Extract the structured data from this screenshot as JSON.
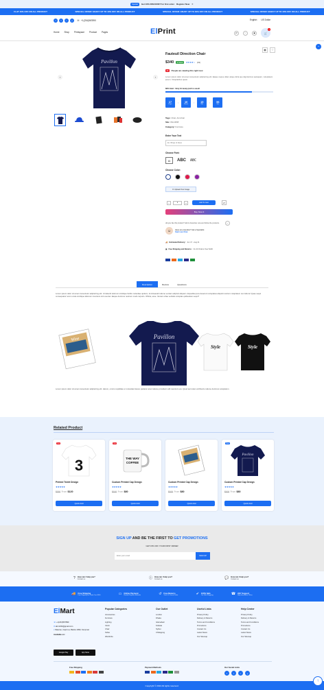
{
  "promo_bar": {
    "badge": "Special",
    "text": "Get 10% DISCOUNT for first order",
    "cta": "Register Now"
  },
  "ticker": [
    "FLAT 40% OFF ON ALL PRODUCT",
    "SPECIAL OFFER: ENJOY UP TO 40% OFF ON ALL PRODUCT",
    "SPECIAL OFFER: ENJOY UP TO 40% OFF ON ALL PRODUCT",
    "SPECIAL OFFER: ENJOY UP TO 40% OFF ON ALL PRODUCT"
  ],
  "header": {
    "phone": "+1(234)567890",
    "language": "English",
    "currency": "US Dollar",
    "logo_a": "El",
    "logo_b": "Print",
    "cart_count": "0"
  },
  "nav": [
    "Home",
    "Shop",
    "Printspace",
    "Product",
    "Pages"
  ],
  "product": {
    "title": "Fauteuil Direction Chair",
    "price": "$340",
    "stock": "In Stock",
    "reviews": "(19)",
    "viewers_badge": "29",
    "viewers": "People are viewing this right now",
    "desc": "Lorem ipsum dolor sit amet consectetur adipisicing elit. Eaque neque ullam atque dicta quo dignissimos quisquam, voluptatem ipsum. Voluptatibus quasi.",
    "sold": "80% Sold : Only 10 item(s) left in stock!",
    "sold_pct": 0.8,
    "countdown": [
      {
        "n": "17",
        "l": "Days"
      },
      {
        "n": "10",
        "l": "Hours"
      },
      {
        "n": "15",
        "l": "Min"
      },
      {
        "n": "56",
        "l": "Sec"
      }
    ],
    "tags_label": "Tags:",
    "tags": "Chair, Armchair",
    "sku_label": "Sku:",
    "sku": "WH-0068",
    "cat_label": "Category:",
    "cat": "Furniture",
    "enter_text": "Enter Your Text",
    "text_placeholder": "Ex: Wings of Ideas",
    "font_label": "Choose Font:",
    "fonts": [
      "ABC",
      "ABC"
    ],
    "color_label": "Choose Color:",
    "colors": [
      "#ffffff",
      "#111111",
      "#e0184a",
      "#8a1fa3"
    ],
    "upload": "Upload Your Image",
    "qty": "1",
    "add_to_cart": "Add To Cart",
    "buy_now": "Buy Now It",
    "fav_text": "did you like this product? Add to Favorites now and follow the products.",
    "question": "Have any Question? Ask a Specialist",
    "live_chat": "Start Live Chat",
    "delivery_label": "Estimated Delivery:",
    "delivery": "Jun 17 - Aug 21",
    "ship_label": "Free Shipping and Returns:",
    "ship": "On All Orders Over $100"
  },
  "tabs": [
    "Description",
    "Review",
    "Questions"
  ],
  "description": {
    "p1": "Lorem ipsum dolor sit amet consectetur adipisicing elit. Ut deleniti dolorum similique facilis molestiae quidem, id obcaecati ratione veniam adipisci aliquam. Expedita quos deserunt voluptates aliquid nostrum voluptatem rem labore! Quae sequi consequatur rerum unde similique laborum inventore sint eveniet. Eaque ducimus nostrum modi corporis. Officia, esse. Veniam vitae veritatis voluptas quibusdam sequi?",
    "p2": "Lorem ipsum dolor sit amet consectetur adipisicing elit. Harum, omnis cupiditate ut molestias facere pariatur amet ratione provident odit nesciunt eos. Quod aut totam architecto ratione ducimus voluptatum."
  },
  "related": {
    "title": "Related Product",
    "items": [
      {
        "badge": "Hot",
        "name": "Printed Tshirt Design",
        "old": "$150",
        "from": "From",
        "price": "$120",
        "btn": "Quick Add"
      },
      {
        "badge": "Hot",
        "name": "Custom Printed Cap Design",
        "old": "$100",
        "from": "From",
        "price": "$80",
        "btn": "Quick Add"
      },
      {
        "badge": "",
        "name": "Custom Printed Cap Design",
        "old": "$100",
        "from": "From",
        "price": "$80",
        "btn": "Quick Add"
      },
      {
        "badge": "New",
        "name": "Custom Printed Cap Design",
        "old": "$100",
        "from": "From",
        "price": "$80",
        "btn": "Quick Add"
      }
    ]
  },
  "newsletter": {
    "a": "SIGN UP",
    "b": " AND BE THE FIRST TO ",
    "c": "GET PROMOTIONS",
    "sub": "GET 15% OFF YOUR FIRST ORDER",
    "placeholder": "Enter your email",
    "btn": "SIGN UP"
  },
  "help": [
    {
      "t": "How can I help you?",
      "s": "Contact us"
    },
    {
      "t": "How can I help you?",
      "s": "Contact us"
    },
    {
      "t": "How can I help you?",
      "s": "Contact us"
    }
  ],
  "features": [
    {
      "t": "Free Shipping",
      "s": "Free Shipping For Order Over $100"
    },
    {
      "t": "Online Payment",
      "s": "Flexible Payment Methods"
    },
    {
      "t": "Free Returns",
      "s": "Track Or Cancel Order"
    },
    {
      "t": "100% Safe",
      "s": "Our Safe Shopping"
    },
    {
      "t": "24/7 Support",
      "s": "Help from Alarm Officer"
    }
  ],
  "footer": {
    "logo_a": "El",
    "logo_b": "Mart",
    "phone": "+1(234)567890",
    "email": "abc1234@gmail.com",
    "addr": "Maecee, Capri-La, Bekira 1990, Kenpmat",
    "available": "Available on:",
    "gplay": "Google Play",
    "appstore": "App Store",
    "cols": [
      {
        "h": "Popular Categories",
        "items": [
          "Accessories",
          "Furniture",
          "Lighting",
          "Clock",
          "Chair",
          "Sofas",
          "Wardrobe"
        ]
      },
      {
        "h": "Our Outlet",
        "items": [
          "London",
          "Dhaka",
          "Islamabad",
          "Kolkata",
          "Sylhet",
          "Chittagong"
        ]
      },
      {
        "h": "Useful Links",
        "items": [
          "Privacy Policy",
          "Delivery & Returns",
          "Terms and Conditions",
          "Promotions",
          "Contact Us",
          "Latest News",
          "Our Sitemap"
        ]
      },
      {
        "h": "Help Center",
        "items": [
          "Privacy Policy",
          "Delivery & Returns",
          "Terms and Conditions",
          "Promotions",
          "Contact Us",
          "Latest News",
          "Our Sitemap"
        ]
      }
    ],
    "ship_label": "Free Shipping",
    "pay_label": "Payment Methods",
    "social_label": "Our Social Links",
    "copyright": "Copyright © 2024 All rights reserved."
  }
}
